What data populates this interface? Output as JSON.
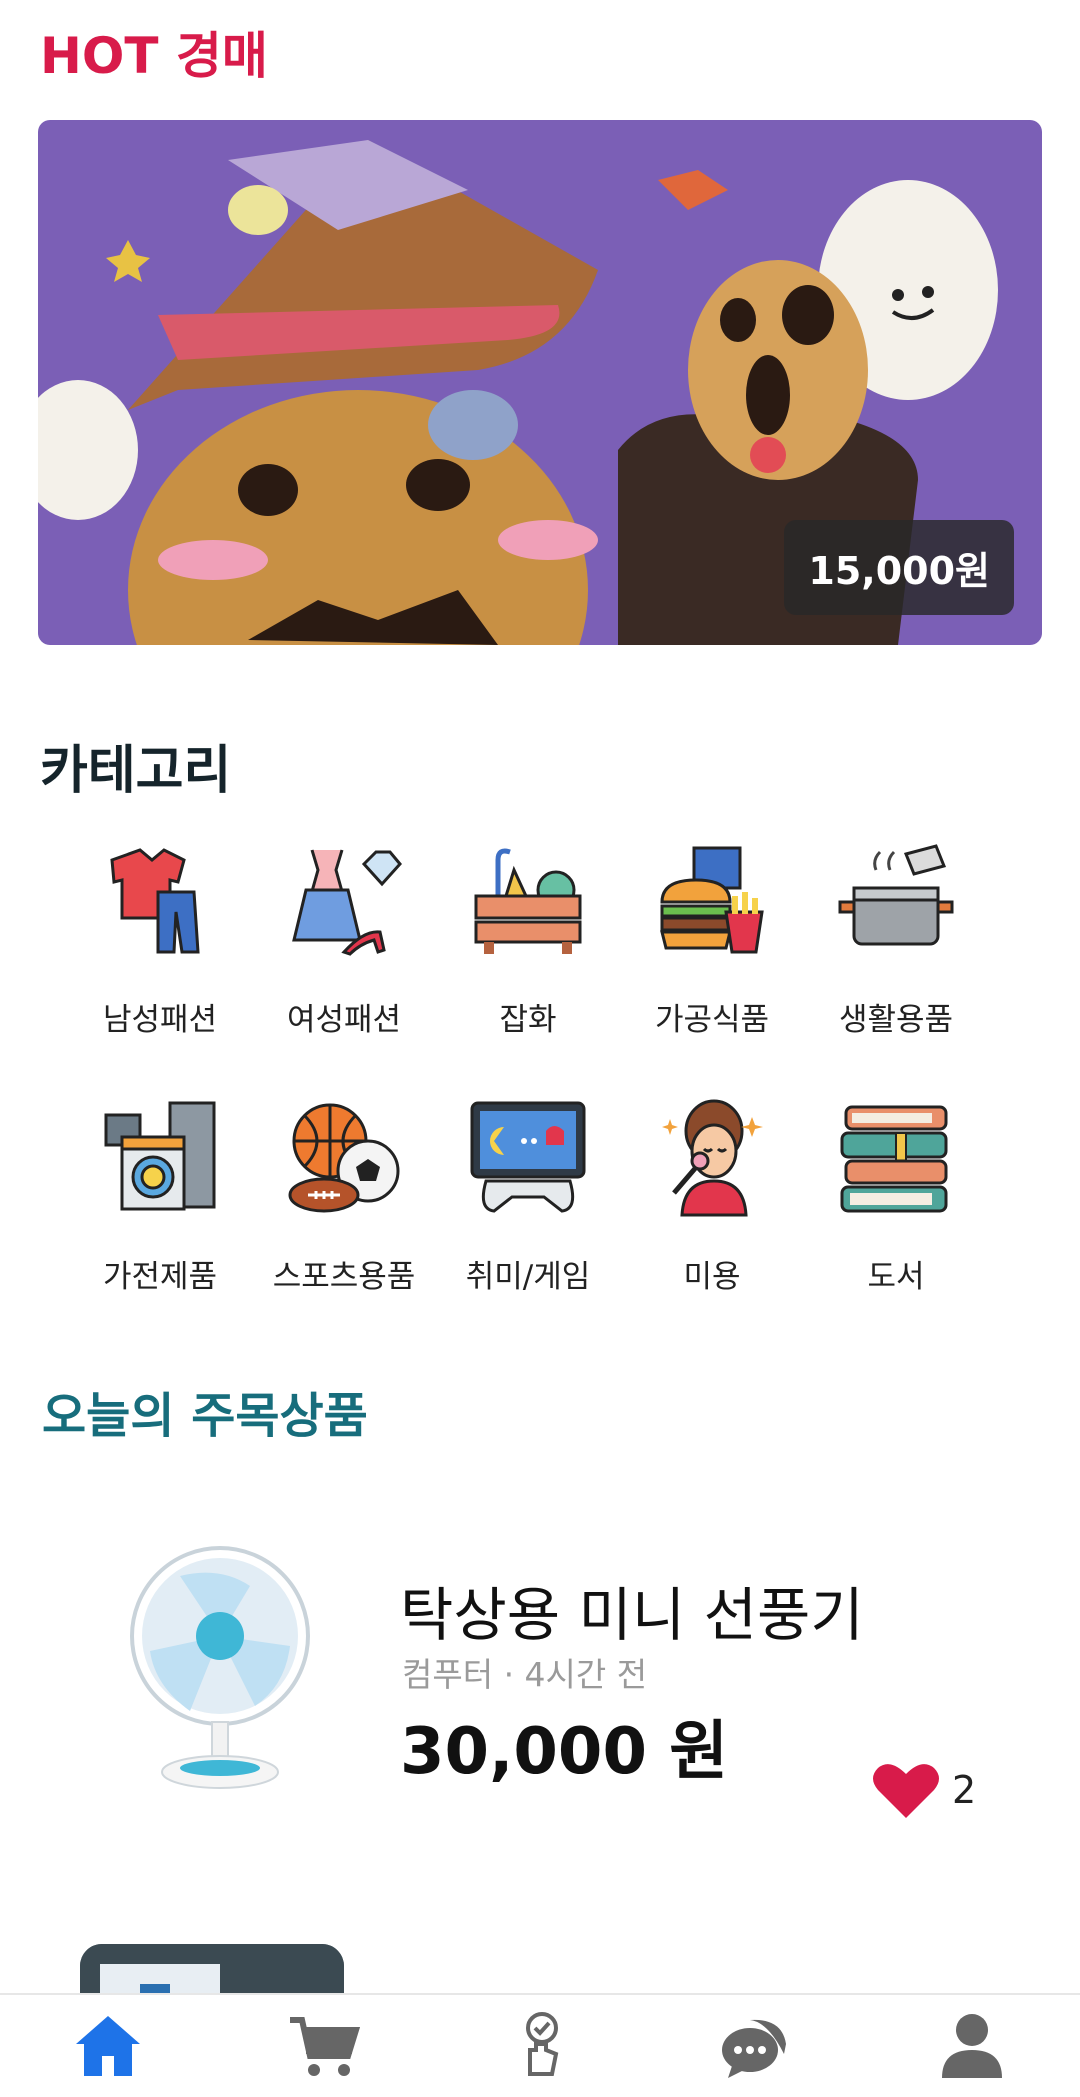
{
  "hot": {
    "title": "HOT 경매",
    "price": "15,000원"
  },
  "categories": {
    "title": "카테고리",
    "items": [
      {
        "label": "남성패션",
        "icon": "menswear-icon"
      },
      {
        "label": "여성패션",
        "icon": "womenswear-icon"
      },
      {
        "label": "잡화",
        "icon": "goods-crate-icon"
      },
      {
        "label": "가공식품",
        "icon": "fastfood-icon"
      },
      {
        "label": "생활용품",
        "icon": "cooking-pot-icon"
      },
      {
        "label": "가전제품",
        "icon": "appliances-icon"
      },
      {
        "label": "스포츠용품",
        "icon": "sports-balls-icon"
      },
      {
        "label": "취미/게임",
        "icon": "game-monitor-icon"
      },
      {
        "label": "미용",
        "icon": "beauty-icon"
      },
      {
        "label": "도서",
        "icon": "books-icon"
      }
    ]
  },
  "today": {
    "title": "오늘의 주목상품",
    "products": [
      {
        "name": "탁상용 미니 선풍기",
        "meta": "컴푸터 · 4시간 전",
        "price": "30,000 원",
        "likes": "2"
      }
    ]
  },
  "nav": {
    "items": [
      "home-icon",
      "cart-icon",
      "auction-hand-icon",
      "chat-icon",
      "profile-icon"
    ],
    "active": "home-icon"
  },
  "colors": {
    "hot": "#d81b4a",
    "today": "#176d7c",
    "heart": "#d81b4a",
    "nav_active": "#1e73e8",
    "nav_inactive": "#666666"
  }
}
